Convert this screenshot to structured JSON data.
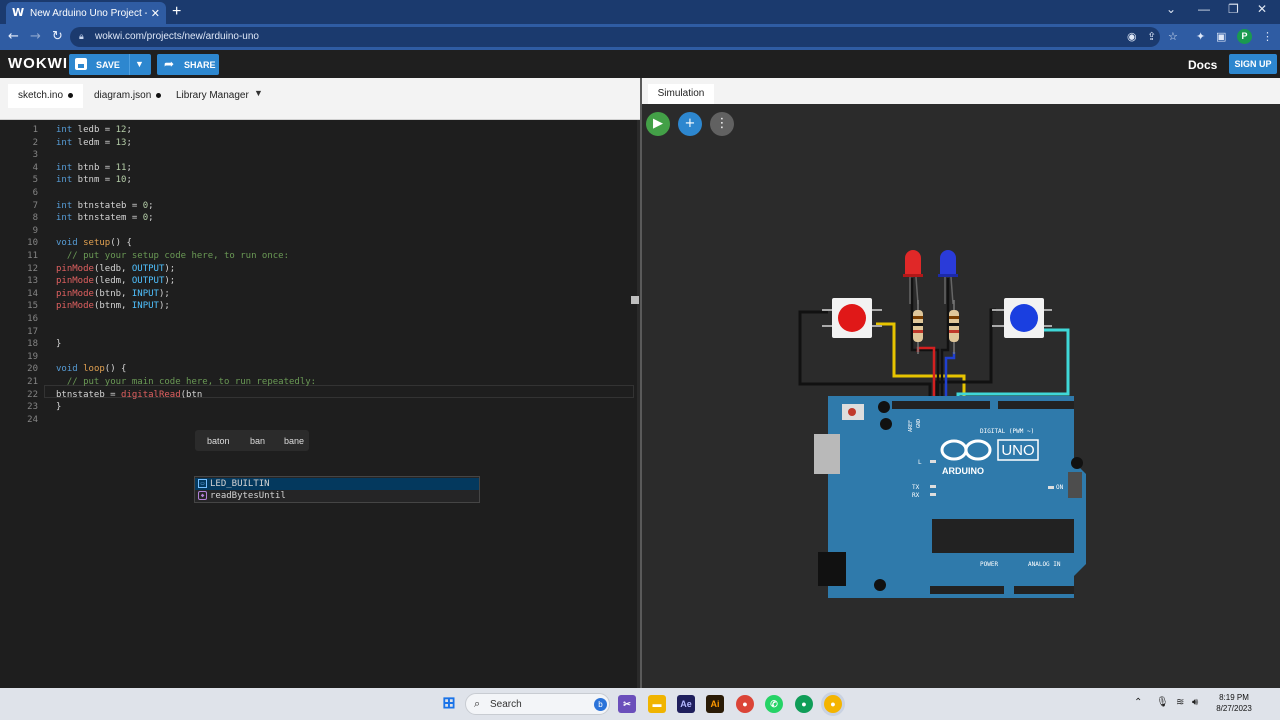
{
  "browser": {
    "tab_title": "New Arduino Uno Project - Wokwi",
    "tab_favicon": "W",
    "url": "wokwi.com/projects/new/arduino-uno",
    "profile_initial": "P"
  },
  "header": {
    "logo": "WOKWI",
    "save_label": "SAVE",
    "share_label": "SHARE",
    "docs_label": "Docs",
    "signup_label": "SIGN UP"
  },
  "editor": {
    "tabs": [
      {
        "label": "sketch.ino",
        "modified": true,
        "active": true
      },
      {
        "label": "diagram.json",
        "modified": true,
        "active": false
      },
      {
        "label": "Library Manager",
        "modified": false,
        "active": false
      }
    ],
    "lines": [
      {
        "n": "1",
        "text": "int ledb = 12;"
      },
      {
        "n": "2",
        "text": "int ledm = 13;"
      },
      {
        "n": "3",
        "text": ""
      },
      {
        "n": "4",
        "text": "int btnb = 11;"
      },
      {
        "n": "5",
        "text": "int btnm = 10;"
      },
      {
        "n": "6",
        "text": ""
      },
      {
        "n": "7",
        "text": "int btnstateb = 0;"
      },
      {
        "n": "8",
        "text": "int btnstatem = 0;"
      },
      {
        "n": "9",
        "text": ""
      },
      {
        "n": "10",
        "text": "void setup() {"
      },
      {
        "n": "11",
        "text": "  // put your setup code here, to run once:"
      },
      {
        "n": "12",
        "text": "pinMode(ledb, OUTPUT);"
      },
      {
        "n": "13",
        "text": "pinMode(ledm, OUTPUT);"
      },
      {
        "n": "14",
        "text": "pinMode(btnb, INPUT);"
      },
      {
        "n": "15",
        "text": "pinMode(btnm, INPUT);"
      },
      {
        "n": "16",
        "text": ""
      },
      {
        "n": "17",
        "text": ""
      },
      {
        "n": "18",
        "text": "}"
      },
      {
        "n": "19",
        "text": ""
      },
      {
        "n": "20",
        "text": "void loop() {"
      },
      {
        "n": "21",
        "text": "  // put your main code here, to run repeatedly:"
      },
      {
        "n": "22",
        "text": "btnstateb = digitalRead(btn"
      },
      {
        "n": "23",
        "text": "}"
      },
      {
        "n": "24",
        "text": ""
      }
    ],
    "word_suggestions": [
      "baton",
      "ban",
      "bane"
    ],
    "autocomplete": [
      {
        "label": "LED_BUILTIN",
        "kind": "constant-icon",
        "selected": true
      },
      {
        "label": "readBytesUntil",
        "kind": "method-icon",
        "selected": false
      }
    ]
  },
  "simulation": {
    "tab_label": "Simulation",
    "board_label": "UNO",
    "board_brand": "ARDUINO",
    "board_texts": {
      "digital": "DIGITAL (PWM ~)",
      "analog": "ANALOG IN",
      "power": "POWER",
      "on": "ON",
      "tx": "TX",
      "rx": "RX",
      "l": "L",
      "aref": "AREF",
      "gnd": "GND"
    },
    "leds": [
      "red",
      "blue"
    ],
    "buttons": [
      "red",
      "blue"
    ]
  },
  "taskbar": {
    "search_label": "Search",
    "time": "8:19 PM",
    "date": "8/27/2023"
  },
  "colors": {
    "wokwi_blue": "#2d87cf",
    "play_green": "#43a047"
  }
}
